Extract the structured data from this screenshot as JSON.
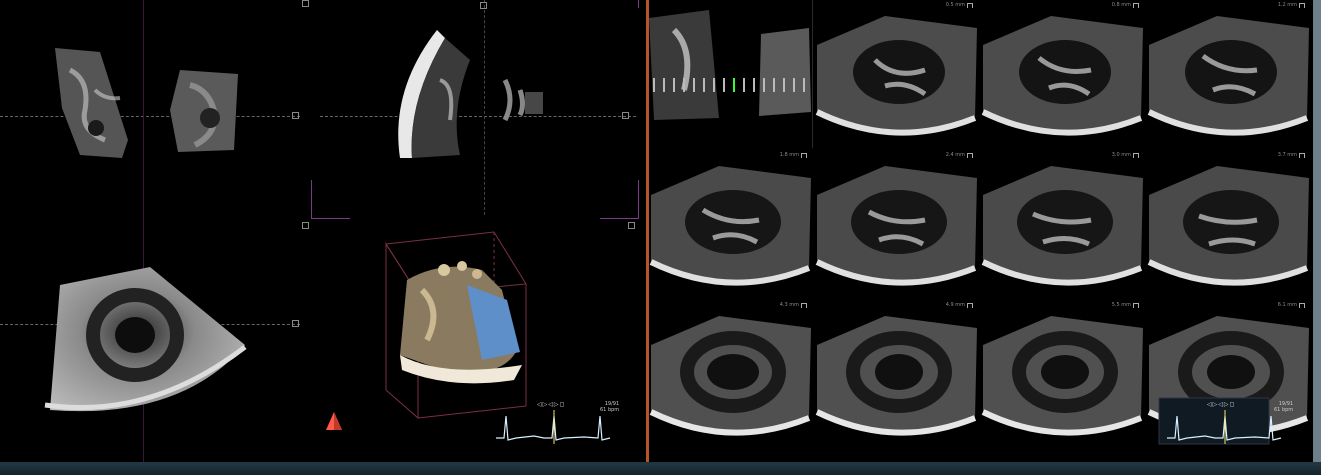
{
  "left_pane": {
    "playback_label": "◁▷◁▷◻",
    "readout_line1": "19/91",
    "readout_line2": "61 bpm"
  },
  "right_pane": {
    "playback_label": "◁▷◁▷◻",
    "readout_line1": "19/91",
    "readout_line2": "61 bpm",
    "tiles": [
      {
        "depth": ""
      },
      {
        "depth": "0.5 mm"
      },
      {
        "depth": "0.8 mm"
      },
      {
        "depth": "1.2 mm"
      },
      {
        "depth": "1.8 mm"
      },
      {
        "depth": "2.4 mm"
      },
      {
        "depth": "3.0 mm"
      },
      {
        "depth": "3.7 mm"
      },
      {
        "depth": "4.3 mm"
      },
      {
        "depth": "4.9 mm"
      },
      {
        "depth": "5.5 mm"
      },
      {
        "depth": "6.1 mm"
      }
    ]
  },
  "colors": {
    "divider": "#b8542a",
    "guide_bracket": "#7a3a88",
    "orientation_marker": "#ff5a4a",
    "ecg_trace": "#d8f0ff",
    "ecg_marker": "#ffe070"
  },
  "icons": {
    "orientation": "pyramid-orientation-icon",
    "playback": "playback-controls-icon"
  }
}
